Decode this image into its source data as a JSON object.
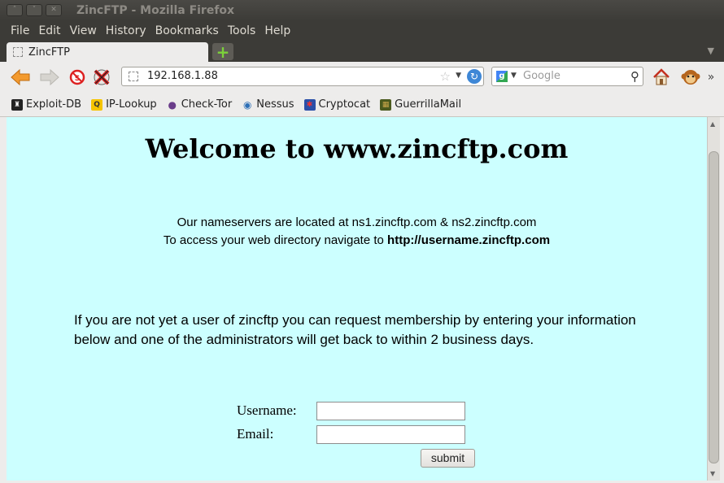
{
  "window": {
    "title": "ZincFTP - Mozilla Firefox"
  },
  "menu": [
    "File",
    "Edit",
    "View",
    "History",
    "Bookmarks",
    "Tools",
    "Help"
  ],
  "tab": {
    "label": "ZincFTP"
  },
  "urlbar": {
    "value": "192.168.1.88"
  },
  "search": {
    "placeholder": "Google"
  },
  "bookmarks": [
    "Exploit-DB",
    "IP-Lookup",
    "Check-Tor",
    "Nessus",
    "Cryptocat",
    "GuerrillaMail"
  ],
  "page": {
    "heading": "Welcome to www.zincftp.com",
    "ns_line": "Our nameservers are located at ns1.zincftp.com & ns2.zincftp.com",
    "access_prefix": "To access your web directory navigate to ",
    "access_url": "http://username.zincftp.com",
    "info": "If you are not yet a user of zincftp you can request membership by entering your information below and one of the administrators will get back to within 2 business days.",
    "username_label": "Username:",
    "email_label": "Email:",
    "submit_label": "submit"
  },
  "colors": {
    "page_bg": "#ccffff",
    "chrome_bg": "#edeceb",
    "titlebar_bg": "#3c3b37"
  }
}
